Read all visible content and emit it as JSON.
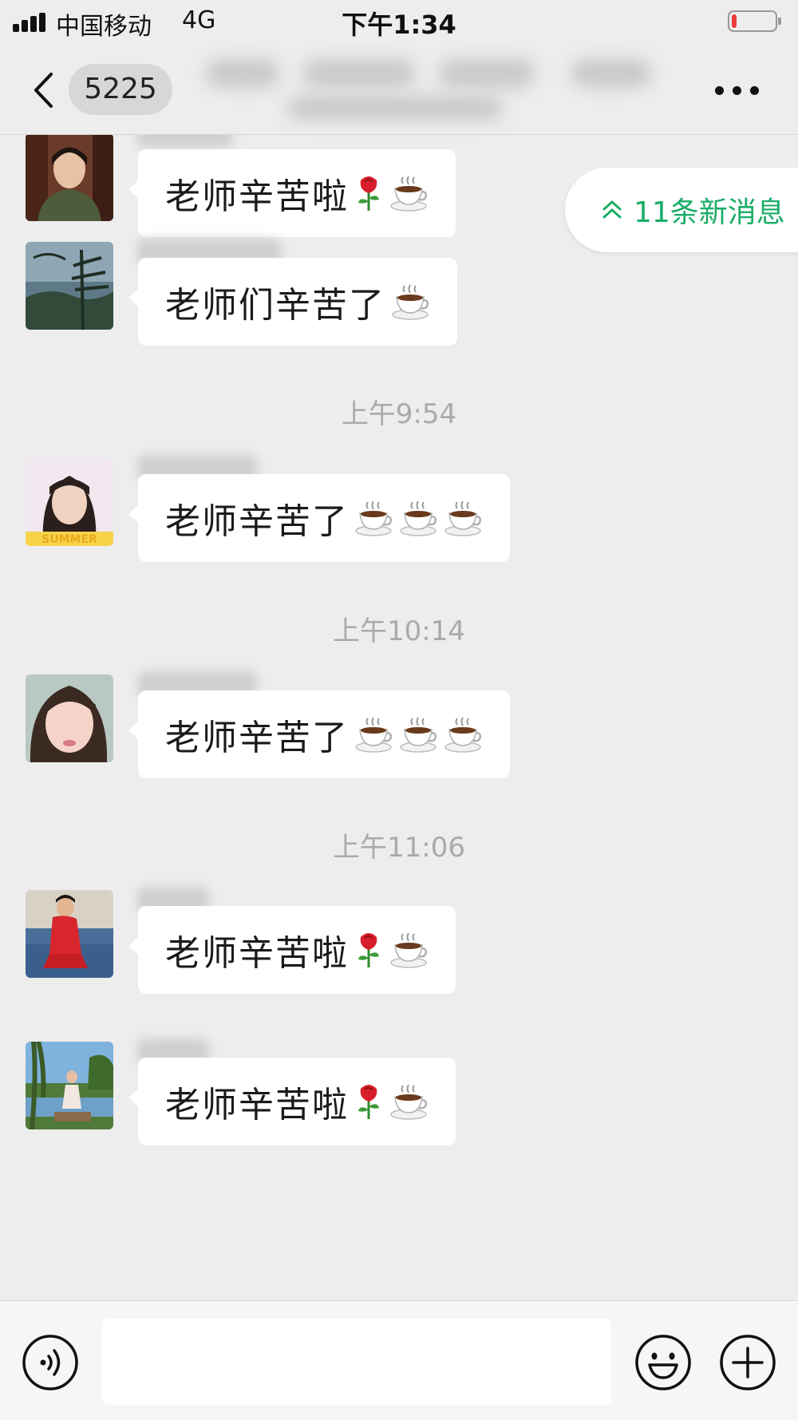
{
  "status_bar": {
    "carrier": "中国移动",
    "network": "4G",
    "time": "下午1:34",
    "battery_level": 0.12,
    "battery_color": "#ef3b3b"
  },
  "nav": {
    "back_icon": "chevron-left-icon",
    "unread_count": "5225",
    "more_icon": "ellipsis-icon"
  },
  "new_messages_pill": {
    "icon": "double-chevron-up-icon",
    "label": "11条新消息",
    "color": "#1aad67"
  },
  "messages": [
    {
      "type": "message",
      "text": "老师辛苦啦",
      "emojis": [
        "rose",
        "coffee"
      ]
    },
    {
      "type": "message",
      "text": "老师们辛苦了",
      "emojis": [
        "coffee"
      ]
    },
    {
      "type": "timestamp",
      "text": "上午9:54"
    },
    {
      "type": "message",
      "text": "老师辛苦了",
      "emojis": [
        "coffee",
        "coffee",
        "coffee"
      ]
    },
    {
      "type": "timestamp",
      "text": "上午10:14"
    },
    {
      "type": "message",
      "text": "老师辛苦了",
      "emojis": [
        "coffee",
        "coffee",
        "coffee"
      ]
    },
    {
      "type": "timestamp",
      "text": "上午11:06"
    },
    {
      "type": "message",
      "text": "老师辛苦啦",
      "emojis": [
        "rose",
        "coffee"
      ]
    },
    {
      "type": "message",
      "text": "老师辛苦啦",
      "emojis": [
        "rose",
        "coffee"
      ]
    }
  ],
  "input_bar": {
    "voice_icon": "voice-icon",
    "text_value": "",
    "emoji_icon": "smiley-icon",
    "plus_icon": "plus-icon"
  }
}
